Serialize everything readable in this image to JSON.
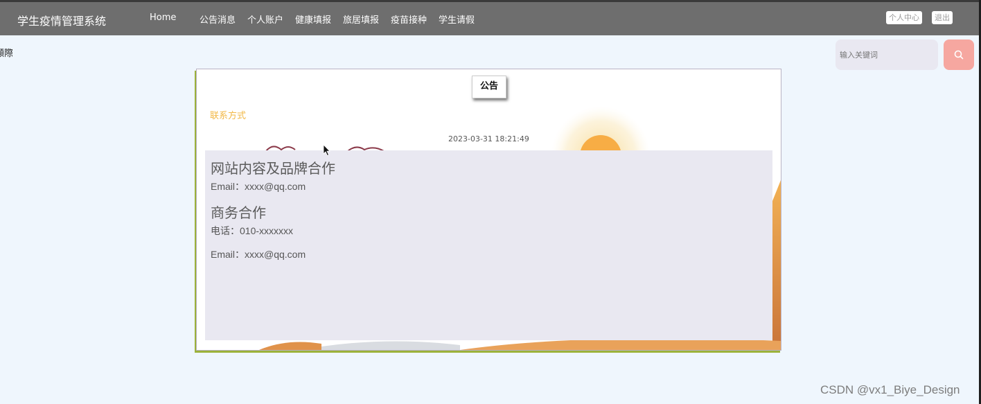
{
  "navbar": {
    "brand": "学生疫情管理系统",
    "items": [
      {
        "label": "Home"
      },
      {
        "label": "公告消息"
      },
      {
        "label": "个人账户"
      },
      {
        "label": "健康填报"
      },
      {
        "label": "旅居填报"
      },
      {
        "label": "疫苗接种"
      },
      {
        "label": "学生请假"
      }
    ],
    "personal_center": "个人中心",
    "logout": "退出"
  },
  "left_fragment": "顯際",
  "search": {
    "placeholder": "输入关键词",
    "icon": "search-icon"
  },
  "notice": {
    "title": "公告",
    "subtitle": "联系方式",
    "date": "2023-03-31 18:21:49",
    "sections": [
      {
        "heading": "网站内容及品牌合作",
        "lines": [
          "Email：xxxx@qq.com"
        ]
      },
      {
        "heading": "商务合作",
        "lines": [
          "电话：010-xxxxxxx",
          "Email：xxxx@qq.com"
        ]
      }
    ]
  },
  "watermark": "CSDN @vx1_Biye_Design",
  "colors": {
    "navbar_bg": "#6e6e6e",
    "page_bg": "#eff6fd",
    "subtitle": "#f2b846",
    "search_button": "#f6a7a0",
    "content_bg": "#e9e8f1"
  }
}
